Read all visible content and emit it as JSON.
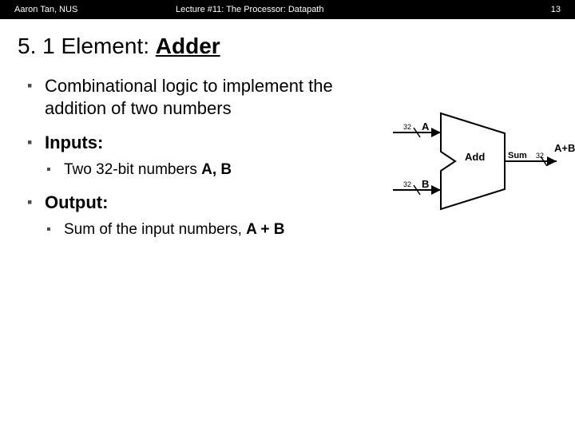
{
  "header": {
    "author": "Aaron Tan, NUS",
    "title": "Lecture #11: The Processor: Datapath",
    "page": "13"
  },
  "titlePrefix": "5. 1 Element: ",
  "titleMain": "Adder",
  "bullets": {
    "combi": "Combinational logic to implement the addition of two numbers",
    "inputsLabel": "Inputs:",
    "inputsSub": "Two 32-bit numbers ",
    "inputsSubBold": "A, B",
    "outputLabel": "Output:",
    "outputSub": "Sum of the input numbers, ",
    "outputSubBold": "A + B"
  },
  "diagram": {
    "A": "A",
    "B": "B",
    "APB": "A+B",
    "w": "32",
    "add": "Add",
    "sum": "Sum"
  }
}
